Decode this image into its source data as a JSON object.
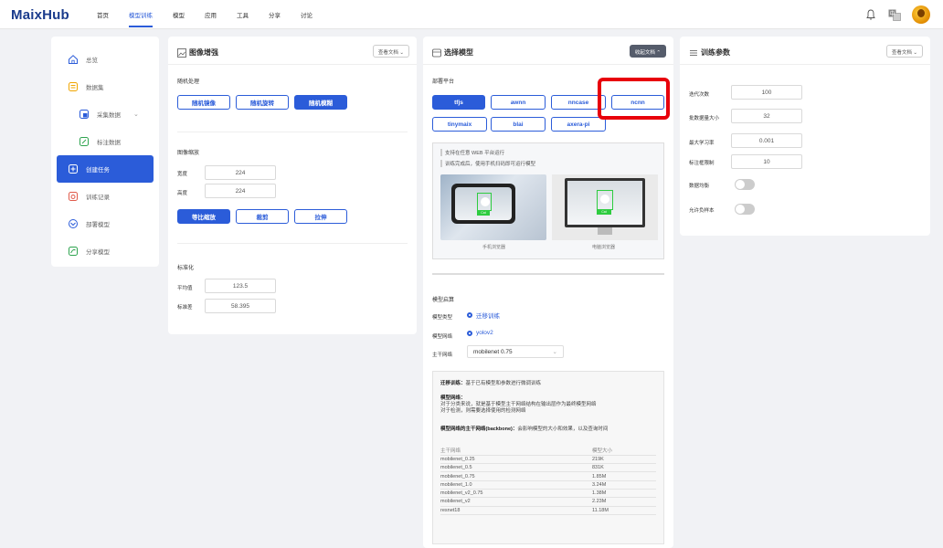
{
  "header": {
    "logo": "MaixHub",
    "nav": [
      "首页",
      "模型训练",
      "模型",
      "应用",
      "工具",
      "分享",
      "讨论"
    ],
    "active_nav": 1
  },
  "sidebar": {
    "items": [
      {
        "label": "总览",
        "icon": "home-icon"
      },
      {
        "label": "数据集",
        "icon": "dataset-icon"
      },
      {
        "label": "采集数据",
        "icon": "collect-icon",
        "sub": true,
        "chevron": "⌄"
      },
      {
        "label": "标注数据",
        "icon": "annotate-icon",
        "sub": true
      },
      {
        "label": "创建任务",
        "icon": "plus-icon",
        "active": true
      },
      {
        "label": "训练记录",
        "icon": "record-icon"
      },
      {
        "label": "部署模型",
        "icon": "deploy-icon"
      },
      {
        "label": "分享模型",
        "icon": "share-icon"
      }
    ]
  },
  "augment": {
    "title": "图像增强",
    "doc_button": "查看文档 ⌄",
    "random_label": "随机处理",
    "random_buttons": [
      "随机镜像",
      "随机旋转",
      "随机模糊"
    ],
    "scale_label": "图像缩放",
    "width_label": "宽度",
    "width_value": "224",
    "height_label": "高度",
    "height_value": "224",
    "scale_buttons": [
      "等比缩放",
      "裁剪",
      "拉伸"
    ],
    "norm_label": "标准化",
    "mean_label": "平均值",
    "mean_value": "123.5",
    "std_label": "标准差",
    "std_value": "58.395"
  },
  "model": {
    "title": "选择模型",
    "doc_button": "收起文档 ⌃",
    "platform_label": "部署平台",
    "platforms": [
      "tfjs",
      "awnn",
      "nncase",
      "ncnn",
      "tinymaix",
      "blai",
      "axera-pi"
    ],
    "preview_line1": "支持在任意 WEB 平台运行",
    "preview_line2": "训练完成后，使用手机扫码即可运行模型",
    "cat_tag": "Cat",
    "phone_caption": "手机浏览器",
    "pc_caption": "电脑浏览器",
    "algo_label": "模型启算",
    "type_label": "模型类型",
    "type_value": "迁移训练",
    "net_label": "模型网络",
    "net_value": "yolov2",
    "backbone_label": "主干网络",
    "backbone_value": "mobilenet 0.75",
    "info_title": "迁移训练：",
    "info_title_desc": "基于已有模型和参数进行微调训练",
    "info_net_title": "模型网络：",
    "info_net_desc1": "对于分类来说，就是基于模型主干网络结构在输出层作为最终模型网络",
    "info_net_desc2": "对于检测，则需要选择使用的检测网络",
    "info_bb_title": "模型网络的主干网络(backbone)：",
    "info_bb_desc": "会影响模型的大小和效果，以及查询时间",
    "table_headers": [
      "主干网络",
      "模型大小"
    ],
    "table_rows": [
      [
        "mobilenet_0.25",
        "219K"
      ],
      [
        "mobilenet_0.5",
        "831K"
      ],
      [
        "mobilenet_0.75",
        "1.85M"
      ],
      [
        "mobilenet_1.0",
        "3.24M"
      ],
      [
        "mobilenet_v2_0.75",
        "1.38M"
      ],
      [
        "mobilenet_v2",
        "2.23M"
      ],
      [
        "resnet18",
        "11.18M"
      ]
    ]
  },
  "params": {
    "title": "训练参数",
    "doc_button": "查看文档 ⌄",
    "rows": [
      {
        "label": "迭代次数",
        "value": "100"
      },
      {
        "label": "批数据量大小",
        "value": "32"
      },
      {
        "label": "最大学习率",
        "value": "0.001"
      },
      {
        "label": "标注框限制",
        "value": "10"
      }
    ],
    "balance_label": "数据均衡",
    "negative_label": "允许负样本"
  },
  "colors": {
    "accent": "#2b5cd9",
    "highlight": "#e8000b"
  }
}
